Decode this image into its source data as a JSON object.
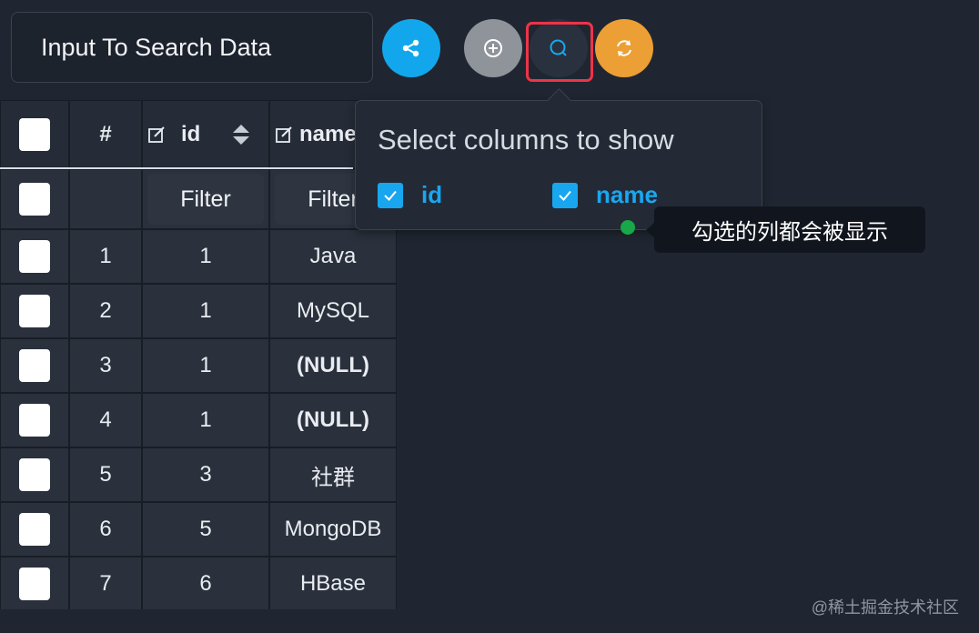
{
  "search": {
    "text": "Input To Search Data"
  },
  "buttons": {
    "share": "share-icon",
    "add": "plus-circle-icon",
    "search": "search-icon",
    "refresh": "refresh-icon"
  },
  "colors": {
    "share": "#12a7ec",
    "add": "#8f939a",
    "refresh": "#ec9f35",
    "highlight": "#ef3348",
    "checkbox": "#18a6ee",
    "tooltip_dot": "#17a848"
  },
  "table": {
    "headers": {
      "index": "#",
      "id": "id",
      "name": "name"
    },
    "filter_label": "Filter",
    "rows": [
      {
        "index": "1",
        "id": "1",
        "name": "Java"
      },
      {
        "index": "2",
        "id": "1",
        "name": "MySQL"
      },
      {
        "index": "3",
        "id": "1",
        "name": "(NULL)"
      },
      {
        "index": "4",
        "id": "1",
        "name": "(NULL)"
      },
      {
        "index": "5",
        "id": "3",
        "name": "社群"
      },
      {
        "index": "6",
        "id": "5",
        "name": "MongoDB"
      },
      {
        "index": "7",
        "id": "6",
        "name": "HBase"
      }
    ]
  },
  "popover": {
    "title": "Select columns to show",
    "options": [
      {
        "label": "id",
        "checked": true
      },
      {
        "label": "name",
        "checked": true
      }
    ]
  },
  "tooltip": {
    "text": "勾选的列都会被显示"
  },
  "watermark": "@稀土掘金技术社区"
}
